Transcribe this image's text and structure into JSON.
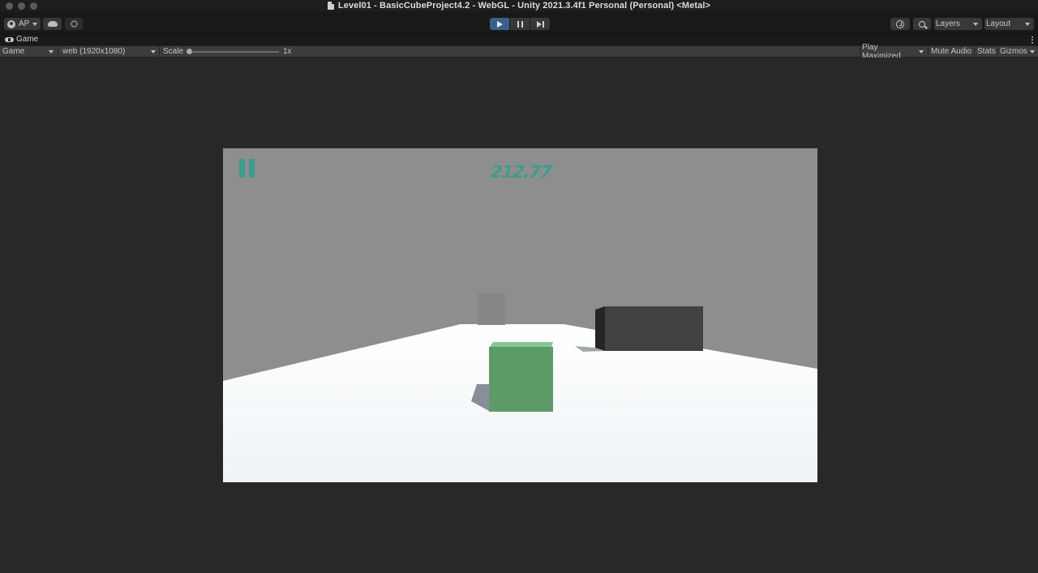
{
  "window": {
    "title": "Level01 - BasicCubeProject4.2 - WebGL - Unity 2021.3.4f1 Personal (Personal) <Metal>"
  },
  "toolbar": {
    "account_label": "AP",
    "play_controls": [
      "play",
      "pause",
      "step"
    ],
    "play_active": true,
    "layers_label": "Layers",
    "layout_label": "Layout"
  },
  "tabs": {
    "game_label": "Game"
  },
  "game_toolbar": {
    "display_label": "Game",
    "resolution_label": "web (1920x1080)",
    "scale_label": "Scale",
    "scale_value": "1x",
    "play_maximized_label": "Play Maximized",
    "mute_audio_label": "Mute Audio",
    "stats_label": "Stats",
    "gizmos_label": "Gizmos"
  },
  "game": {
    "score": "212.77",
    "hud_color": "#3b9d8d",
    "sky_color": "#8e8e8e",
    "ground_color": "#f4f7f9",
    "player_color": "#5e9a67",
    "obstacle_color": "#434142"
  }
}
